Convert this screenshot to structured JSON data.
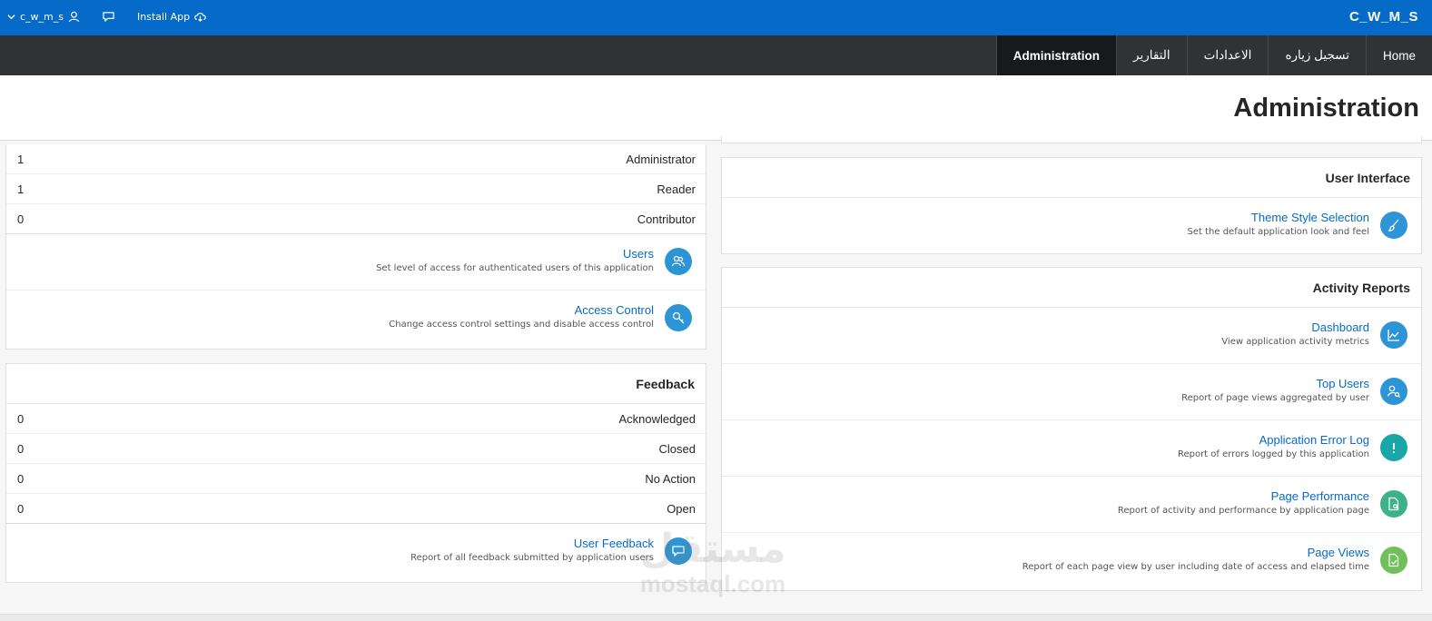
{
  "topbar": {
    "user_label": "c_w_m_s",
    "install_label": "Install App",
    "brand": "C_W_M_S"
  },
  "nav": {
    "items": [
      "Home",
      "تسجيل زياره",
      "الاعدادات",
      "التقارير",
      "Administration"
    ],
    "active": "Administration"
  },
  "page": {
    "title": "Administration"
  },
  "roles": {
    "rows": [
      {
        "label": "Administrator",
        "count": "1"
      },
      {
        "label": "Reader",
        "count": "1"
      },
      {
        "label": "Contributor",
        "count": "0"
      }
    ],
    "links": [
      {
        "title": "Users",
        "desc": "Set level of access for authenticated users of this application",
        "icon": "users-icon"
      },
      {
        "title": "Access Control",
        "desc": "Change access control settings and disable access control",
        "icon": "key-icon"
      }
    ]
  },
  "feedback": {
    "title": "Feedback",
    "rows": [
      {
        "label": "Acknowledged",
        "count": "0"
      },
      {
        "label": "Closed",
        "count": "0"
      },
      {
        "label": "No Action",
        "count": "0"
      },
      {
        "label": "Open",
        "count": "0"
      }
    ],
    "link": {
      "title": "User Feedback",
      "desc": "Report of all feedback submitted by application users",
      "icon": "speech-bubble-icon"
    }
  },
  "ui": {
    "title": "User Interface",
    "link": {
      "title": "Theme Style Selection",
      "desc": "Set the default application look and feel",
      "icon": "paintbrush-icon"
    }
  },
  "activity": {
    "title": "Activity Reports",
    "items": [
      {
        "title": "Dashboard",
        "desc": "View application activity metrics",
        "icon": "chart-icon"
      },
      {
        "title": "Top Users",
        "desc": "Report of page views aggregated by user",
        "icon": "user-search-icon"
      },
      {
        "title": "Application Error Log",
        "desc": "Report of errors logged by this application",
        "icon": "exclamation-icon"
      },
      {
        "title": "Page Performance",
        "desc": "Report of activity and performance by application page",
        "icon": "page-search-icon"
      },
      {
        "title": "Page Views",
        "desc": "Report of each page view by user including date of access and elapsed time",
        "icon": "page-check-icon"
      }
    ]
  },
  "watermark": {
    "arabic": "مستقل",
    "latin": "mostaql.com"
  },
  "colors": {
    "topbar": "#056ac8",
    "navbar": "#303336",
    "nav_active": "#18191b",
    "link": "#056ac8"
  }
}
